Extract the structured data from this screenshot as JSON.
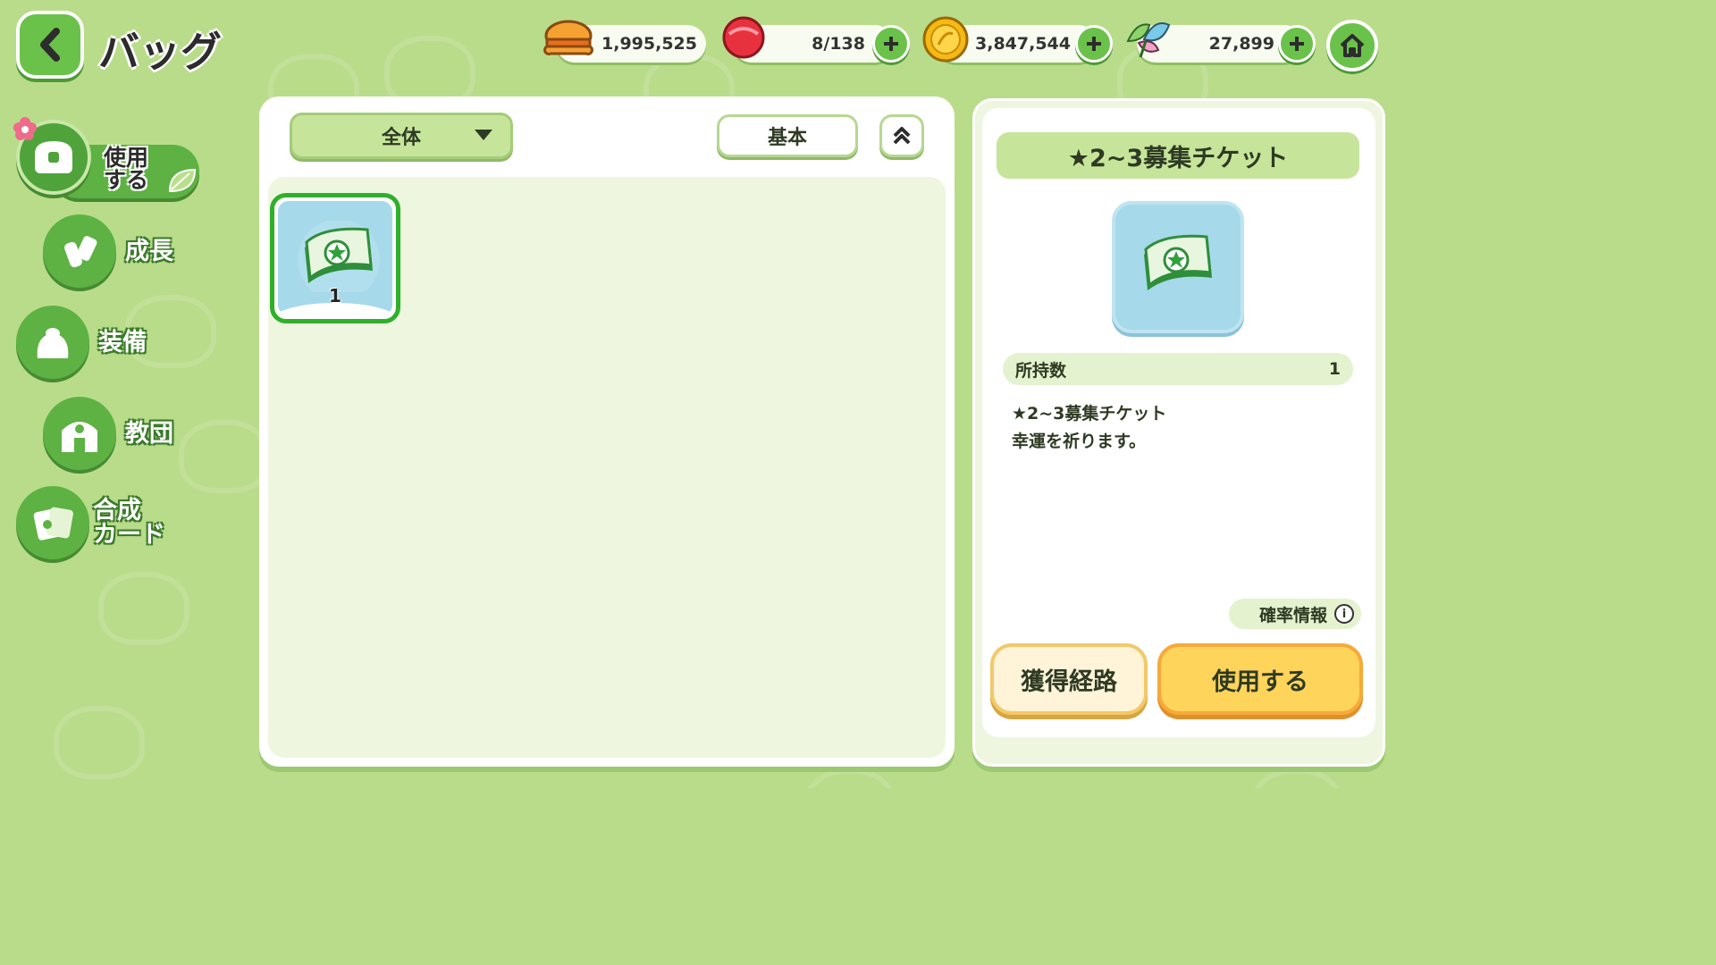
{
  "header": {
    "title": "バッグ",
    "currencies": [
      {
        "name": "burger-currency",
        "value": "1,995,525"
      },
      {
        "name": "red-gem-currency",
        "value": "8/138"
      },
      {
        "name": "gold-coin-currency",
        "value": "3,847,544"
      },
      {
        "name": "rainbow-leaf-currency",
        "value": "27,899"
      }
    ]
  },
  "sidebar": {
    "items": [
      {
        "label_line1": "使用",
        "label_line2": "する",
        "icon": "chest-icon",
        "active": true
      },
      {
        "label": "成長",
        "icon": "potion-icon"
      },
      {
        "label": "装備",
        "icon": "outfit-icon"
      },
      {
        "label": "教団",
        "icon": "temple-icon"
      },
      {
        "label_line1": "合成",
        "label_line2": "カード",
        "icon": "card-icon"
      }
    ]
  },
  "main": {
    "filter_label": "全体",
    "sort_label": "基本",
    "items": [
      {
        "icon": "ticket-icon",
        "count": "1"
      }
    ]
  },
  "detail": {
    "title": "★2~3募集チケット",
    "owned_label": "所持数",
    "owned_value": "1",
    "description_line1": "★2~3募集チケット",
    "description_line2": "幸運を祈ります。",
    "prob_info_label": "確率情報",
    "source_button": "獲得経路",
    "use_button": "使用する"
  },
  "colors": {
    "background": "#b9dc8a",
    "accent_green": "#5db243",
    "use_button": "#ffd45b"
  }
}
